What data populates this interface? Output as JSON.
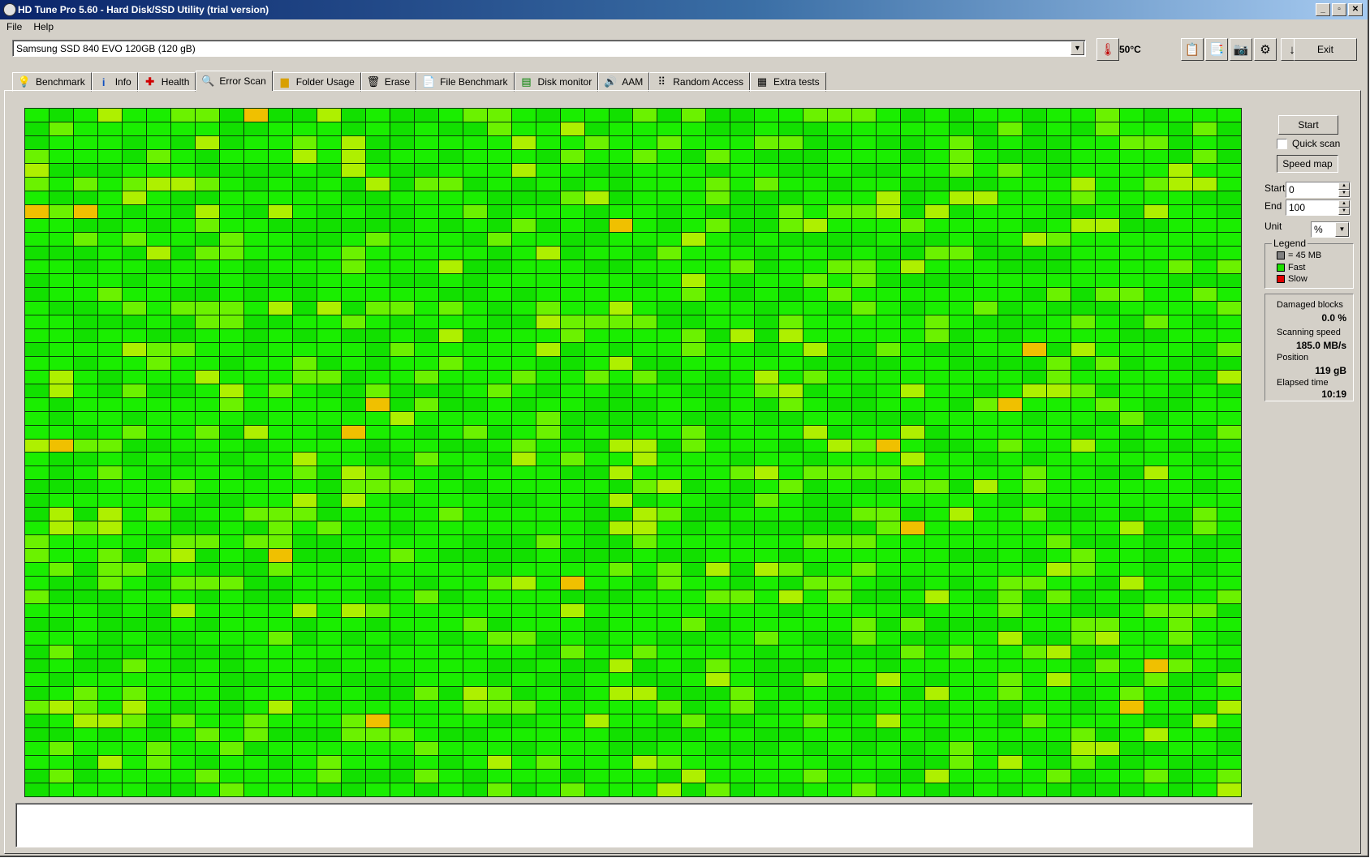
{
  "window": {
    "title": "HD Tune Pro 5.60 - Hard Disk/SSD Utility (trial version)",
    "controls": [
      "_",
      "▫",
      "✕"
    ]
  },
  "menu": [
    "File",
    "Help"
  ],
  "toolbar": {
    "drive": "Samsung SSD 840 EVO 120GB (120 gB)",
    "temperature": "50°C",
    "exit_label": "Exit"
  },
  "tabs": [
    {
      "label": "Benchmark",
      "icon": "benchmark-icon"
    },
    {
      "label": "Info",
      "icon": "info-icon"
    },
    {
      "label": "Health",
      "icon": "health-icon"
    },
    {
      "label": "Error Scan",
      "icon": "error-scan-icon"
    },
    {
      "label": "Folder Usage",
      "icon": "folder-icon"
    },
    {
      "label": "Erase",
      "icon": "erase-icon"
    },
    {
      "label": "File Benchmark",
      "icon": "file-benchmark-icon"
    },
    {
      "label": "Disk monitor",
      "icon": "disk-monitor-icon"
    },
    {
      "label": "AAM",
      "icon": "aam-icon"
    },
    {
      "label": "Random Access",
      "icon": "random-access-icon"
    },
    {
      "label": "Extra tests",
      "icon": "extra-tests-icon"
    }
  ],
  "active_tab": "Error Scan",
  "side": {
    "start_button": "Start",
    "quick_scan_label": "Quick scan",
    "quick_scan_checked": false,
    "speed_map_button": "Speed map",
    "start_label": "Start",
    "start_value": "0",
    "end_label": "End",
    "end_value": "100",
    "unit_label": "Unit",
    "unit_value": "%"
  },
  "legend": {
    "caption": "Legend",
    "items": [
      {
        "label": "= 45 MB",
        "color": "#808080"
      },
      {
        "label": "Fast",
        "color": "#1ee000"
      },
      {
        "label": "Slow",
        "color": "#e00000"
      }
    ]
  },
  "stats": {
    "damaged_label": "Damaged blocks",
    "damaged_value": "0.0 %",
    "speed_label": "Scanning speed",
    "speed_value": "185.0 MB/s",
    "position_label": "Position",
    "position_value": "119 gB",
    "elapsed_label": "Elapsed time",
    "elapsed_value": "10:19"
  },
  "scan_grid": {
    "columns": 50,
    "rows": 50,
    "colors": {
      "fast": "#1aee00",
      "fast_dark": "#12e000",
      "medium": "#6bf200",
      "slower": "#aef000",
      "slowest": "#f0c000"
    }
  }
}
